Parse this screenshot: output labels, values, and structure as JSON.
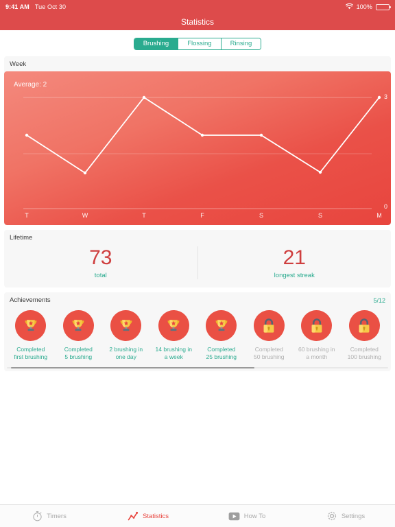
{
  "status_bar": {
    "time": "9:41 AM",
    "date": "Tue Oct 30",
    "wifi_icon": "wifi-icon",
    "battery_percent": "100%",
    "battery_icon": "battery-full-icon",
    "background": "#dd4b4b"
  },
  "nav": {
    "title": "Statistics"
  },
  "segmented": {
    "options": [
      {
        "label": "Brushing",
        "selected": true
      },
      {
        "label": "Flossing",
        "selected": false
      },
      {
        "label": "Rinsing",
        "selected": false
      }
    ],
    "accent": "#2aab8f"
  },
  "week": {
    "title": "Week",
    "average_label": "Average: 2"
  },
  "chart_data": {
    "type": "line",
    "title": "Week",
    "annotation": "Average: 2",
    "categories": [
      "T",
      "W",
      "T",
      "F",
      "S",
      "S",
      "M"
    ],
    "values": [
      2,
      1,
      3,
      2.2,
      2.2,
      1,
      3
    ],
    "xlabel": "",
    "ylabel": "",
    "ylim": [
      0,
      3
    ],
    "ytick_labels": [
      "0",
      "3"
    ],
    "grid": true,
    "legend": "none",
    "line_color": "#ffffff",
    "background_gradient": [
      "#f4897d",
      "#e8453e"
    ]
  },
  "lifetime": {
    "title": "Lifetime",
    "stats": [
      {
        "value": "73",
        "label": "total"
      },
      {
        "value": "21",
        "label": "longest streak"
      }
    ],
    "value_color": "#cf3f3f",
    "label_color": "#2aab8f"
  },
  "achievements": {
    "title": "Achievements",
    "progress": "5/12",
    "items": [
      {
        "label": "Completed\nfirst brushing",
        "icon": "trophy-icon",
        "unlocked": true
      },
      {
        "label": "Completed\n5 brushing",
        "icon": "trophy-icon",
        "unlocked": true
      },
      {
        "label": "2 brushing in\none day",
        "icon": "trophy-icon",
        "unlocked": true
      },
      {
        "label": "14 brushing in\na week",
        "icon": "trophy-icon",
        "unlocked": true
      },
      {
        "label": "Completed\n25 brushing",
        "icon": "trophy-icon",
        "unlocked": true
      },
      {
        "label": "Completed\n50 brushing",
        "icon": "lock-icon",
        "unlocked": false
      },
      {
        "label": "60 brushing in\na month",
        "icon": "lock-icon",
        "unlocked": false
      },
      {
        "label": "Completed\n100 brushing",
        "icon": "lock-icon",
        "unlocked": false
      }
    ]
  },
  "tabbar": {
    "tabs": [
      {
        "label": "Timers",
        "icon": "stopwatch-icon",
        "active": false
      },
      {
        "label": "Statistics",
        "icon": "line-chart-icon",
        "active": true
      },
      {
        "label": "How To",
        "icon": "video-play-icon",
        "active": false
      },
      {
        "label": "Settings",
        "icon": "gear-icon",
        "active": false
      }
    ],
    "active_color": "#e8453e",
    "inactive_color": "#a8a8a8"
  }
}
